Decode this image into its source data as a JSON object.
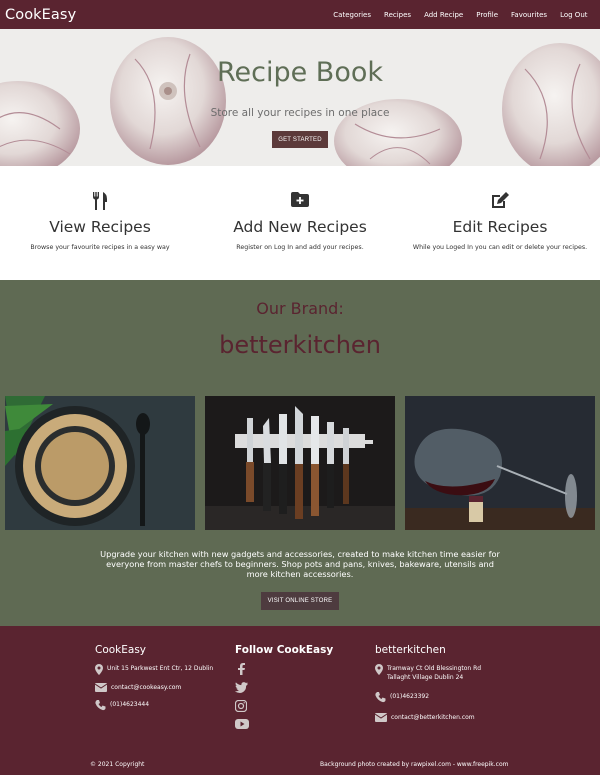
{
  "nav": {
    "brand": "CookEasy",
    "links": [
      "Categories",
      "Recipes",
      "Add Recipe",
      "Profile",
      "Favourites",
      "Log Out"
    ]
  },
  "hero": {
    "title": "Recipe Book",
    "subtitle": "Store all your recipes in one place",
    "button": "GET STARTED"
  },
  "features": [
    {
      "icon": "utensils-icon",
      "title": "View Recipes",
      "text": "Browse your favourite recipes in a easy way"
    },
    {
      "icon": "folder-plus-icon",
      "title": "Add New Recipes",
      "text": "Register on Log In and add your recipes."
    },
    {
      "icon": "edit-icon",
      "title": "Edit Recipes",
      "text": "While you Loged In you can edit or delete your recipes."
    }
  ],
  "brand": {
    "heading": "Our Brand:",
    "name": "betterkitchen",
    "description": "Upgrade your kitchen with new gadgets and accessories, created to make kitchen time easier for everyone from master chefs to beginners. Shop pots and pans, knives, bakeware, utensils and more kitchen accessories.",
    "button": "VISIT ONLINE STORE"
  },
  "footer": {
    "col1": {
      "heading": "CookEasy",
      "address": "Unit 15 Parkwest Ent Ctr, 12 Dublin",
      "email": "contact@cookeasy.com",
      "phone": "(01)4623444"
    },
    "col2": {
      "heading": "Follow CookEasy",
      "socials": [
        "facebook-icon",
        "twitter-icon",
        "instagram-icon",
        "youtube-icon"
      ]
    },
    "col3": {
      "heading": "betterkitchen",
      "address_line1": "Tramway Ct Old Blessington Rd",
      "address_line2": "Tallaght Village Dublin 24",
      "phone": "(01)4623392",
      "email": "contact@betterkitchen.com"
    },
    "copyright": "© 2021 Copyright",
    "credit": "Background photo created by rawpixel.com - www.freepik.com"
  },
  "colors": {
    "primary": "#5a2430",
    "green": "#5f6a53",
    "button": "#5c3a3a"
  }
}
